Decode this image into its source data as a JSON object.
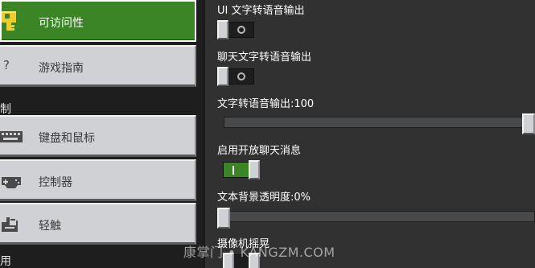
{
  "nav": {
    "items": [
      {
        "label": "可访问性",
        "icon": "key-icon",
        "active": true
      },
      {
        "label": "游戏指南",
        "icon": "question-icon",
        "active": false
      },
      {
        "label": "键盘和鼠标",
        "icon": "keyboard-icon",
        "active": false
      },
      {
        "label": "控制器",
        "icon": "gamepad-icon",
        "active": false
      },
      {
        "label": "轻触",
        "icon": "touch-hand-icon",
        "active": false
      }
    ],
    "sections": {
      "controls_partial": "制",
      "general_partial": "用"
    },
    "question_glyph": "?"
  },
  "settings": {
    "ui_tts": {
      "label": "UI 文字转语音输出",
      "value": false
    },
    "chat_tts": {
      "label": "聊天文字转语音输出",
      "value": false
    },
    "tts_output": {
      "label": "文字转语音输出:100",
      "value_fraction": 1.0
    },
    "open_chat": {
      "label": "启用开放聊天消息",
      "value": true
    },
    "text_bg_opacity": {
      "label": "文本背景透明度:0%",
      "value_fraction": 0.0
    },
    "camera_shake": {
      "label": "摄像机摇晃"
    }
  },
  "watermark": "康掌门 • KANGZM.COM",
  "colors": {
    "accent_green": "#3c8527",
    "button_grey": "#d0d1d4",
    "panel_bg": "#313131",
    "nav_bg": "#1e1e1f"
  }
}
